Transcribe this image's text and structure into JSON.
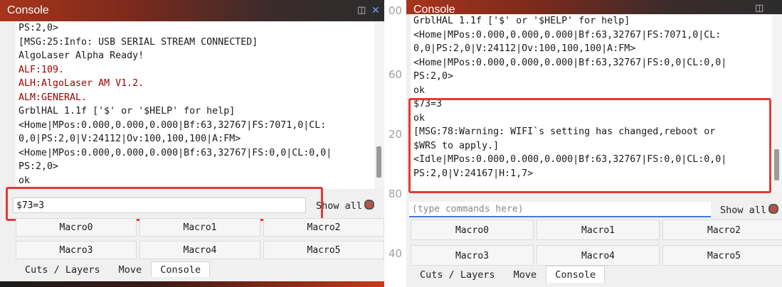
{
  "left": {
    "title": "Console",
    "window_icons": {
      "float": "float-icon",
      "close": "close-icon"
    },
    "console_lines": [
      {
        "text": "PS:2,0>",
        "red": false
      },
      {
        "text": "[MSG:25:Info: USB SERIAL STREAM CONNECTED]",
        "red": false
      },
      {
        "text": "AlgoLaser Alpha Ready!",
        "red": false
      },
      {
        "text": "ALF:109.",
        "red": true
      },
      {
        "text": "ALH:AlgoLaser AM V1.2.",
        "red": true
      },
      {
        "text": "ALM:GENERAL.",
        "red": true
      },
      {
        "text": "GrblHAL 1.1f ['$' or '$HELP' for help]",
        "red": false
      },
      {
        "text": "<Home|MPos:0.000,0.000,0.000|Bf:63,32767|FS:7071,0|CL:",
        "red": false
      },
      {
        "text": "0,0|PS:2,0|V:24112|Ov:100,100,100|A:FM>",
        "red": false
      },
      {
        "text": "<Home|MPos:0.000,0.000,0.000|Bf:63,32767|FS:0,0|CL:0,0|",
        "red": false
      },
      {
        "text": "PS:2,0>",
        "red": false
      },
      {
        "text": "ok",
        "red": false
      }
    ],
    "command_value": "$73=3",
    "show_all_label": "Show all",
    "macros": [
      "Macro0",
      "Macro1",
      "Macro2",
      "Macro3",
      "Macro4",
      "Macro5"
    ],
    "tabs": [
      {
        "label": "Cuts / Layers",
        "active": false
      },
      {
        "label": "Move",
        "active": false
      },
      {
        "label": "Console",
        "active": true
      }
    ]
  },
  "right": {
    "title": "Console",
    "window_icons": {
      "float": "float-icon",
      "close": "close-icon"
    },
    "console_lines": [
      {
        "text": "GrblHAL 1.1f ['$' or '$HELP' for help]"
      },
      {
        "text": "<Home|MPos:0.000,0.000,0.000|Bf:63,32767|FS:7071,0|CL:"
      },
      {
        "text": "0,0|PS:2,0|V:24112|Ov:100,100,100|A:FM>"
      },
      {
        "text": "<Home|MPos:0.000,0.000,0.000|Bf:63,32767|FS:0,0|CL:0,0|"
      },
      {
        "text": "PS:2,0>"
      },
      {
        "text": "ok"
      },
      {
        "text": "$73=3"
      },
      {
        "text": "ok"
      },
      {
        "text": "[MSG:78:Warning: WIFI`s setting has changed,reboot or"
      },
      {
        "text": "$WRS to apply.]"
      },
      {
        "text": "<Idle|MPos:0.000,0.000,0.000|Bf:63,32767|FS:0,0|CL:0,0|"
      },
      {
        "text": "PS:2,0|V:24167|H:1,7>"
      }
    ],
    "command_placeholder": "(type commands here)",
    "show_all_label": "Show all",
    "macros": [
      "Macro0",
      "Macro1",
      "Macro2",
      "Macro3",
      "Macro4",
      "Macro5"
    ],
    "tabs": [
      {
        "label": "Cuts / Layers",
        "active": false
      },
      {
        "label": "Move",
        "active": false
      },
      {
        "label": "Console",
        "active": true
      }
    ]
  },
  "gutter_labels": [
    "00",
    "60",
    "20",
    "80",
    "40"
  ],
  "colors": {
    "highlight": "#e53935",
    "error_text": "#a00000",
    "input_focus": "#3b7dd8"
  }
}
